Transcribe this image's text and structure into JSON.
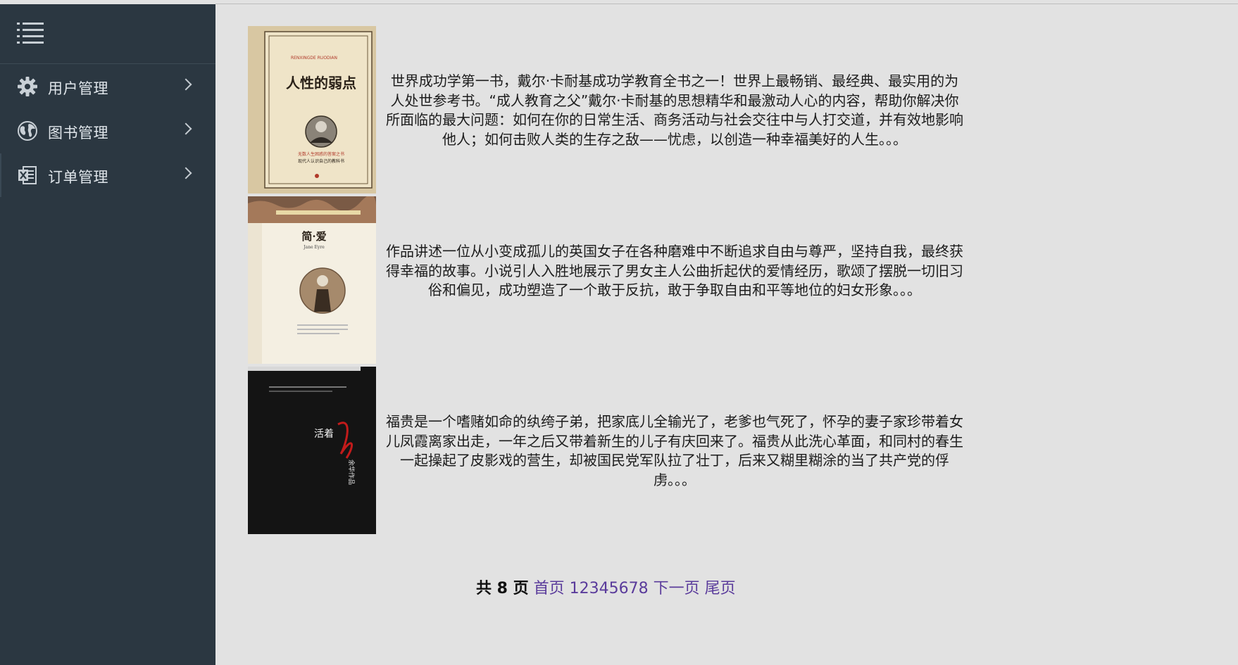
{
  "sidebar": {
    "items": [
      {
        "label": "用户管理",
        "icon": "gear-icon"
      },
      {
        "label": "图书管理",
        "icon": "globe-icon"
      },
      {
        "label": "订单管理",
        "icon": "excel-file-icon"
      }
    ]
  },
  "books": [
    {
      "cover": {
        "title": "人性的弱点",
        "pinyin": "RENXINGDE RUODIAN",
        "subtitle": "无数人生困惑的答案之书",
        "series": "现代人认识自己的教科书"
      },
      "description": "世界成功学第一书，戴尔·卡耐基成功学教育全书之一！世界上最畅销、最经典、最实用的为人处世参考书。“成人教育之父”戴尔·卡耐基的思想精华和最激动人心的内容，帮助你解决你所面临的最大问题：如何在你的日常生活、商务活动与社会交往中与人打交道，并有效地影响他人；如何击败人类的生存之敌——忧虑，以创造一种幸福美好的人生。。。"
    },
    {
      "cover": {
        "title": "简·爱",
        "subtitle": "Jane Eyre"
      },
      "description": "作品讲述一位从小变成孤儿的英国女子在各种磨难中不断追求自由与尊严，坚持自我，最终获得幸福的故事。小说引人入胜地展示了男女主人公曲折起伏的爱情经历，歌颂了摆脱一切旧习俗和偏见，成功塑造了一个敢于反抗，敢于争取自由和平等地位的妇女形象。。。"
    },
    {
      "cover": {
        "title": "活着",
        "subtitle": "余华作品"
      },
      "description": "福贵是一个嗜赌如命的纨绔子弟，把家底儿全输光了，老爹也气死了，怀孕的妻子家珍带着女儿凤霞离家出走，一年之后又带着新生的儿子有庆回来了。福贵从此洗心革面，和同村的春生一起操起了皮影戏的营生，却被国民党军队拉了壮丁，后来又糊里糊涂的当了共产党的俘虏。。。"
    }
  ],
  "pagination": {
    "total_label": "共 8 页",
    "first": "首页",
    "pages": [
      "1",
      "2",
      "3",
      "4",
      "5",
      "6",
      "7",
      "8"
    ],
    "next": "下一页",
    "last": "尾页"
  }
}
